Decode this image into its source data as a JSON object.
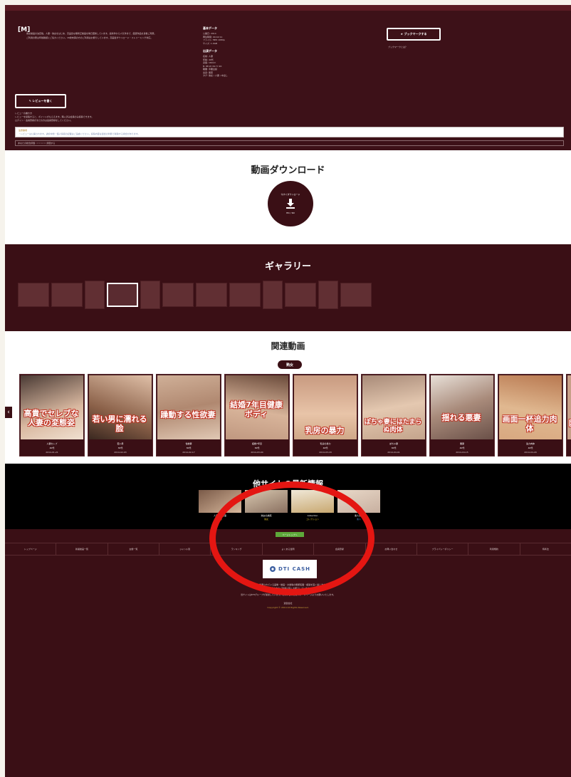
{
  "info": {
    "logo": "[M]",
    "desc_lines": [
      "熟女動画の決定版。人妻・熟女をはじめ、高品質な無修正動画を毎日更新しています。最新作から人気作まで、厳選作品を多数ご用意。",
      "ご利用の際は年齢確認にご協力ください。18歳未満の方のご利用はお断りしています。高画質ダウンロード・ストリーミング対応。"
    ],
    "meta": {
      "basic_heading": "基本データ",
      "basic_rows": [
        "公開日: 2014",
        "再生時間: 00:42:11",
        "ファイル: MP4 1080p",
        "サイズ: 1.4GB"
      ],
      "cast_heading": "出演データ",
      "cast_rows": [
        "名前: 人妻",
        "年齢: 40代",
        "身長: 160cm",
        "B: 88 W: 62 H: 90",
        "職業: 専業主婦",
        "出身: 関東",
        "タグ: 熟女 / 人妻 / 中出し"
      ]
    },
    "bookmark_label": "★ ブックマークする",
    "bookmark_note": "ブックマークとは？",
    "review_label": "✎ レビューを書く",
    "review_notes": [
      "レビューの書き方",
      "レビューを投稿すると、ポイントがもらえます。購入済み会員のみ投稿できます。",
      "ログイン・会員登録がまだの方は会員登録をしてください。"
    ],
    "review_box_title": "注意事項",
    "review_box_text": "・レビューは公開されます。誹謗中傷・個人情報の記載はご遠慮ください。投稿内容は運営の判断で削除する場合があります。",
    "review_foot": "あなたの総合評価: ☆☆☆☆☆ 評価する"
  },
  "download": {
    "title": "動画ダウンロード",
    "caption": "今すぐダウンロード",
    "sub": "HD / SD"
  },
  "gallery": {
    "title": "ギャラリー"
  },
  "related": {
    "title": "関連動画",
    "tab": "熟女",
    "arrow": "‹",
    "cards": [
      {
        "title": "高貴でセレブな人妻の変態姿",
        "l1": "人妻セレブ",
        "l2": "40代",
        "l3": "2014-01-21"
      },
      {
        "title": "若い男に濡れる脸",
        "l1": "若い男",
        "l2": "30代",
        "l3": "2014-02-03"
      },
      {
        "title": "躁動する性欲妻",
        "l1": "性欲妻",
        "l2": "30代",
        "l3": "2014-02-17"
      },
      {
        "title": "結婚7年目健康ボディ",
        "l1": "結婚7年目",
        "l2": "30代",
        "l3": "2014-03-04"
      },
      {
        "title": "乳房の暴力",
        "l1": "乳房の暴力",
        "l2": "40代",
        "l3": "2014-03-18"
      },
      {
        "title": "ぽちゃ妻にはたまらぬ肉体",
        "l1": "ぽちゃ妻",
        "l2": "30代",
        "l3": "2014-04-01"
      },
      {
        "title": "揺れる悪妻",
        "l1": "悪妻",
        "l2": "40代",
        "l3": "2014-04-15"
      },
      {
        "title": "画面一杯追力肉体",
        "l1": "追力肉体",
        "l2": "40代",
        "l3": "2014-04-29"
      },
      {
        "title": "巨",
        "l1": "",
        "l2": "",
        "l3": ""
      }
    ]
  },
  "other_sites": {
    "title": "他サイトの最新情報",
    "sites": [
      {
        "name": "人妻の秘め事",
        "tag": "人妻",
        "tag_color": "#e07a2a"
      },
      {
        "name": "熟女の誘惑",
        "tag": "熟女",
        "tag_color": "#e0c02a"
      },
      {
        "name": "Collection",
        "tag": "コレクション",
        "tag_color": "#e0c02a"
      },
      {
        "name": "素人専科",
        "tag": "素人",
        "tag_color": "#4a8ad0"
      }
    ]
  },
  "footer": {
    "green_btn": "ページトップへ",
    "nav": [
      "トップページ",
      "新着動画一覧",
      "女優一覧",
      "ジャンル別",
      "ランキング",
      "よくある質問",
      "会員登録",
      "お問い合わせ",
      "プライバシーポリシー",
      "利用規約",
      "特商法"
    ],
    "dtic": "DTI CASH",
    "lines": [
      "当サイトに掲載されている画像・動画・文章等の無断転載・複製を固く禁じます。",
      "18歳未満の方のご利用は固くお断りしています。",
      "当サイトはDTIグループが運営しています。お問い合わせはサポートページよりお願いいたします。",
      "運営会社",
      "Copyright © 2014 All Rights Reserved."
    ]
  }
}
